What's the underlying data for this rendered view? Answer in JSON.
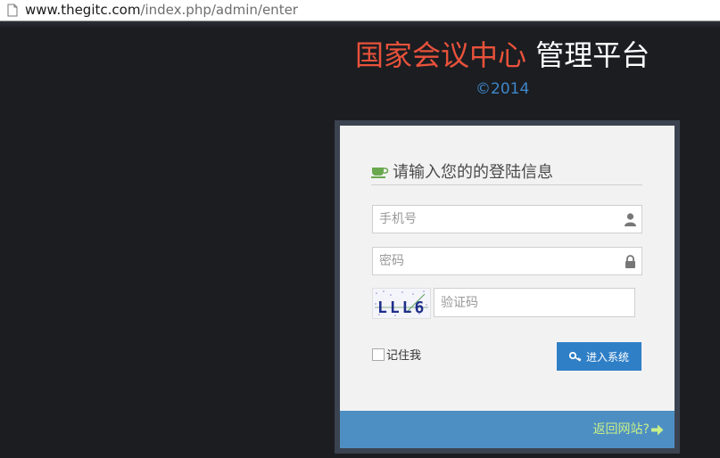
{
  "browser": {
    "url_host": "www.thegitc.com",
    "url_path": "/index.php/admin/enter"
  },
  "header": {
    "title_accent": "国家会议中心",
    "title_main": " 管理平台",
    "copyright": "©2014"
  },
  "login": {
    "heading": "请输入您的的登陆信息",
    "phone_placeholder": "手机号",
    "password_placeholder": "密码",
    "captcha_placeholder": "验证码",
    "captcha_text": "LLL6",
    "remember_label": "记住我",
    "submit_label": "进入系统",
    "back_link": "返回网站?"
  },
  "colors": {
    "page_bg": "#1b1d21",
    "title_accent": "#e8523b",
    "copyright": "#3f87c9",
    "button": "#2f7fc7",
    "footer": "#4e8fc3",
    "heading_icon": "#6aa84f"
  },
  "icons": {
    "page": "document-icon",
    "heading": "coffee-cup-icon",
    "phone_field": "user-icon",
    "password_field": "lock-icon",
    "button": "key-icon",
    "back": "arrow-right-icon"
  }
}
